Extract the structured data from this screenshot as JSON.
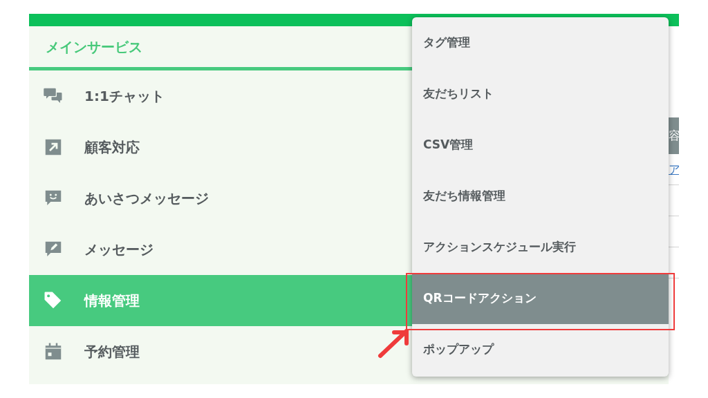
{
  "sidebar": {
    "header": "メインサービス",
    "items": [
      {
        "label": "1:1チャット",
        "kind": "chat",
        "selected": false
      },
      {
        "label": "顧客対応",
        "kind": "arrow",
        "selected": false
      },
      {
        "label": "あいさつメッセージ",
        "kind": "smile",
        "selected": false
      },
      {
        "label": "メッセージ",
        "kind": "pencil",
        "selected": false
      },
      {
        "label": "情報管理",
        "kind": "tag",
        "selected": true
      },
      {
        "label": "予約管理",
        "kind": "calendar",
        "selected": false
      }
    ]
  },
  "dropdown": {
    "items": [
      {
        "label": "タグ管理",
        "selected": false
      },
      {
        "label": "友だちリスト",
        "selected": false
      },
      {
        "label": "CSV管理",
        "selected": false
      },
      {
        "label": "友だち情報管理",
        "selected": false
      },
      {
        "label": "アクションスケジュール実行",
        "selected": false
      },
      {
        "label": "QRコードアクション",
        "selected": true
      },
      {
        "label": "ポップアップ",
        "selected": false
      }
    ]
  },
  "background_table": {
    "header": "容",
    "link": "ア"
  }
}
